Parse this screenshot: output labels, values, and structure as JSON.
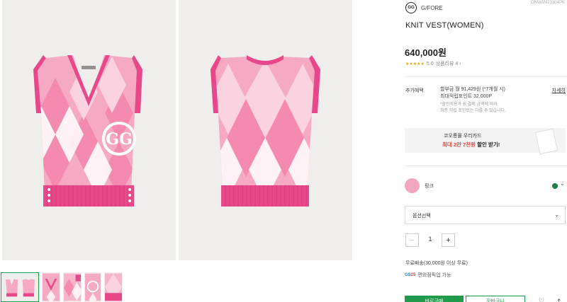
{
  "product": {
    "brand": "G/FORE",
    "brand_logo": "GG",
    "code": "GNWAM23304PK",
    "title": "KNIT VEST(WOMEN)",
    "price": "640,000원",
    "rating_stars": "★★★★★",
    "rating_score": "5.0",
    "review_label": "상품리뷰 4 ›"
  },
  "benefits": {
    "label": "추가혜택",
    "installment": "할부금 월 91,429원 (*7개월 시)",
    "points": "최대적립포인트 32,000P",
    "note_line1": "*할인적용과 쉼 결제 금액에 따라",
    "note_line2": "최종 적립 포인트는 다를 수 있습니다.",
    "detail_link": "자세히"
  },
  "card_banner": {
    "line1": "코오롱몰 우리카드",
    "line2_highlight": "최대 2만 7천원",
    "line2_rest": " 할인 받기!"
  },
  "options": {
    "color_label": "핑크",
    "colors": {
      "selected_swatch": "#f2a6bf",
      "alt_dot": "#1e7e4a"
    },
    "select_placeholder": "옵션선택",
    "quantity": "1",
    "minus": "−",
    "plus": "+"
  },
  "shipping": {
    "free_text": "무료배송(30,000원 이상 무료)",
    "pickup_logo_a": "GS",
    "pickup_logo_b": "25",
    "pickup_text": "편의점픽업 가능"
  },
  "actions": {
    "buy": "바로구매",
    "cart": "장바구니",
    "wish_icon": "♡",
    "share_icon": "⤴"
  },
  "icons": {
    "chevron": "⌄",
    "select_chevron": "⌄"
  },
  "theme": {
    "accent_green": "#1f9b4b",
    "sale_red": "#e6453b",
    "star_gold": "#f0a400",
    "vest_pink": "#f48fb1",
    "vest_hot_pink": "#e8488a"
  }
}
